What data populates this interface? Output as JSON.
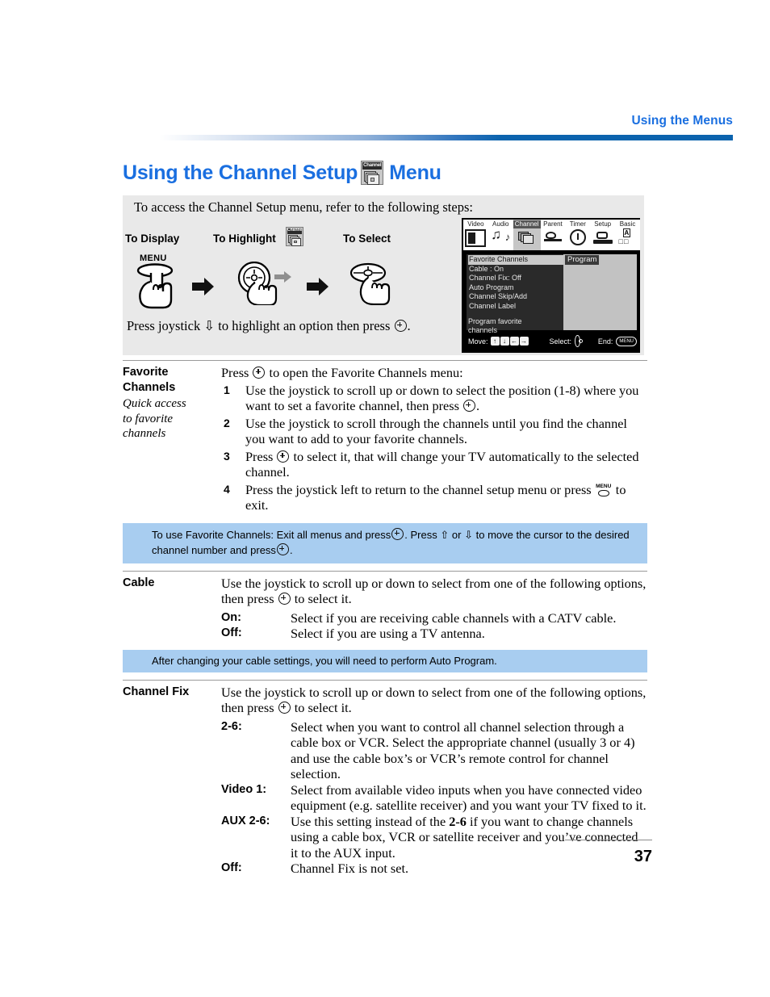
{
  "running_head": "Using the Menus",
  "title": {
    "before_icon": "Using the Channel Setup",
    "icon_label": "Channel",
    "after_icon": "Menu"
  },
  "intro": {
    "text": "To access the Channel Setup menu, refer to the following steps:",
    "labels": {
      "display": "To Display",
      "highlight": "To Highlight",
      "select": "To Select"
    },
    "highlight_icon_label": "Channel",
    "menu_button_label": "MENU",
    "press_line_part1": "Press joystick",
    "press_line_arrow": "⇩",
    "press_line_part2": "to highlight an option then press",
    "press_line_end": "."
  },
  "osd": {
    "tabs": [
      {
        "label": "Video",
        "icon": "video-icon",
        "active": false
      },
      {
        "label": "Audio",
        "icon": "audio-icon",
        "active": false
      },
      {
        "label": "Channel",
        "icon": "channel-icon",
        "active": true
      },
      {
        "label": "Parent",
        "icon": "parent-icon",
        "active": false
      },
      {
        "label": "Timer",
        "icon": "timer-icon",
        "active": false
      },
      {
        "label": "Setup",
        "icon": "setup-icon",
        "active": false
      },
      {
        "label": "Basic",
        "icon": "basic-icon",
        "active": false
      }
    ],
    "menu_items": [
      "Favorite Channels",
      "Cable : On",
      "Channel Fix: Off",
      "Auto Program",
      "Channel Skip/Add",
      "Channel Label"
    ],
    "selected_index": 0,
    "hint_line1": "Program favorite",
    "hint_line2": "channels",
    "right_panel_label": "Program",
    "footer": {
      "move_label": "Move:",
      "keys": [
        "↑",
        "↓",
        "←",
        "→"
      ],
      "select_label": "Select:",
      "end_label": "End:",
      "end_button": "MENU"
    }
  },
  "sections": [
    {
      "term": "Favorite",
      "term2": "Channels",
      "subtitle_lines": [
        "Quick access",
        "to favorite",
        "channels"
      ],
      "lead_before": "Press",
      "lead_after": "to open the Favorite Channels menu:",
      "steps": [
        {
          "num": "1",
          "parts": [
            "Use the joystick to scroll up or down to select the position (1-8) where you want to set a favorite channel, then press ",
            "."
          ],
          "glyph": "joystick-button"
        },
        {
          "num": "2",
          "parts": [
            "Use the joystick to scroll through the channels until you find the channel you want to add to your favorite channels."
          ],
          "glyph": null
        },
        {
          "num": "3",
          "parts": [
            "Press ",
            " to select it, that will change your TV automatically to the selected channel."
          ],
          "glyph": "joystick-button"
        },
        {
          "num": "4",
          "parts": [
            "Press the joystick left to return to the channel setup menu or press ",
            " to exit."
          ],
          "glyph": "menu-button"
        }
      ]
    }
  ],
  "tip1": {
    "part1": "To use Favorite Channels: Exit all menus and press",
    "part2": ". Press",
    "arrow_up": "⇧",
    "or": "or",
    "arrow_down": "⇩",
    "part3": "to move the cursor to the desired channel number and press",
    "part4": "."
  },
  "cable": {
    "term": "Cable",
    "lead_before": "Use the joystick to scroll up or down to select from one of the following options, then press",
    "lead_after": "to select it.",
    "options": [
      {
        "key": "On:",
        "value": "Select if you are receiving cable channels with a CATV cable."
      },
      {
        "key": "Off:",
        "value": "Select if you are using a TV antenna."
      }
    ]
  },
  "tip2": {
    "text": "After changing your cable settings, you will need to perform Auto Program."
  },
  "channel_fix": {
    "term": "Channel Fix",
    "lead_before": "Use the joystick to scroll up or down to select from one of the following options, then press",
    "lead_after": "to select it.",
    "options": [
      {
        "key": "2-6:",
        "value": "Select when you want to control all channel selection through a cable box or VCR. Select the appropriate channel (usually 3 or 4) and use the cable box’s or VCR’s remote control for channel selection."
      },
      {
        "key": "Video 1:",
        "value": "Select from available video inputs when you have connected video equipment (e.g. satellite receiver) and you want your TV fixed to it."
      },
      {
        "key": "AUX 2-6:",
        "value_a": "Use this setting instead of the ",
        "value_bold": "2-6",
        "value_b": " if you want to change channels using a cable box, VCR or satellite receiver and you’ve connected it to the AUX input."
      },
      {
        "key": "Off:",
        "value": "Channel Fix is not set."
      }
    ]
  },
  "folio": "37",
  "colors": {
    "accent_blue": "#1a6fe0",
    "rule_blue": "#0b63ae",
    "tip_blue": "#a8cdf0",
    "panel_gray": "#e9e9e9"
  }
}
